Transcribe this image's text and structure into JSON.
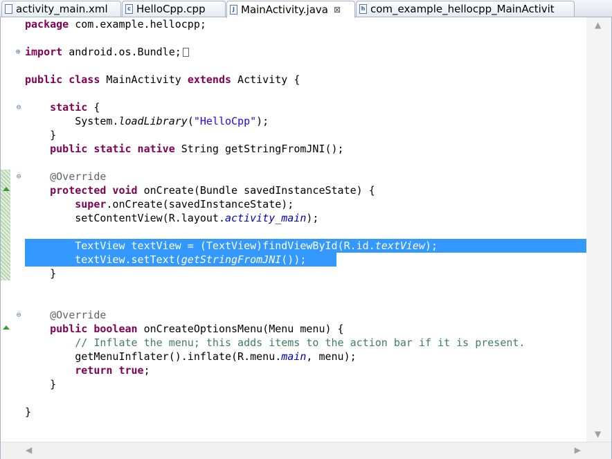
{
  "tabs": [
    {
      "label": "activity_main.xml",
      "icon": "xml-file-icon",
      "active": false
    },
    {
      "label": "HelloCpp.cpp",
      "icon": "cpp-file-icon",
      "active": false
    },
    {
      "label": "MainActivity.java",
      "icon": "java-file-icon",
      "active": true,
      "close": "⊠"
    },
    {
      "label": "com_example_hellocpp_MainActivit",
      "icon": "header-file-icon",
      "active": false
    }
  ],
  "code": {
    "package_kw": "package",
    "package_name": " com.example.hellocpp;",
    "import_kw": "import",
    "import_name": " android.os.Bundle;",
    "class_kw1": "public class",
    "class_name": " MainActivity ",
    "class_kw2": "extends",
    "class_tail": " Activity {",
    "static_kw": "static",
    "static_tail": " {",
    "system_pre": "System.",
    "loadlib": "loadLibrary",
    "paren_open": "(",
    "lib_string": "\"HelloCpp\"",
    "paren_close": ");",
    "close_brace": "}",
    "native_kw": "public static native",
    "native_tail": " String getStringFromJNI();",
    "override": "@Override",
    "oncreate_kw": "protected void",
    "oncreate_tail": " onCreate(Bundle savedInstanceState) {",
    "super_kw": "super",
    "super_tail": ".onCreate(savedInstanceState);",
    "setcv_pre": "setContentView(R.layout.",
    "activity_main": "activity_main",
    "setcv_post": ");",
    "tv_pre": "TextView textView = (TextView)findViewById(R.id.",
    "tv_field": "textView",
    "tv_post": ");",
    "settext_pre": "textView.setText(",
    "settext_method": "getStringFromJNI",
    "settext_post": "());",
    "menu_kw": "public boolean",
    "menu_tail": " onCreateOptionsMenu(Menu menu) {",
    "comment": "// Inflate the menu; this adds items to the action bar if it is present.",
    "inflate_pre": "getMenuInflater().inflate(R.menu.",
    "inflate_field": "main",
    "inflate_post": ", menu);",
    "return_kw": "return",
    "true_kw": "true",
    "semicolon": ";"
  },
  "colors": {
    "keyword": "#7f0055",
    "string": "#2a00ff",
    "annotation": "#646464",
    "comment": "#3f7f5f",
    "field": "#0000c0",
    "selection": "#3399ff"
  },
  "scroll": {
    "up": "▲",
    "down": "▼",
    "left": "◀",
    "right": "▶"
  }
}
